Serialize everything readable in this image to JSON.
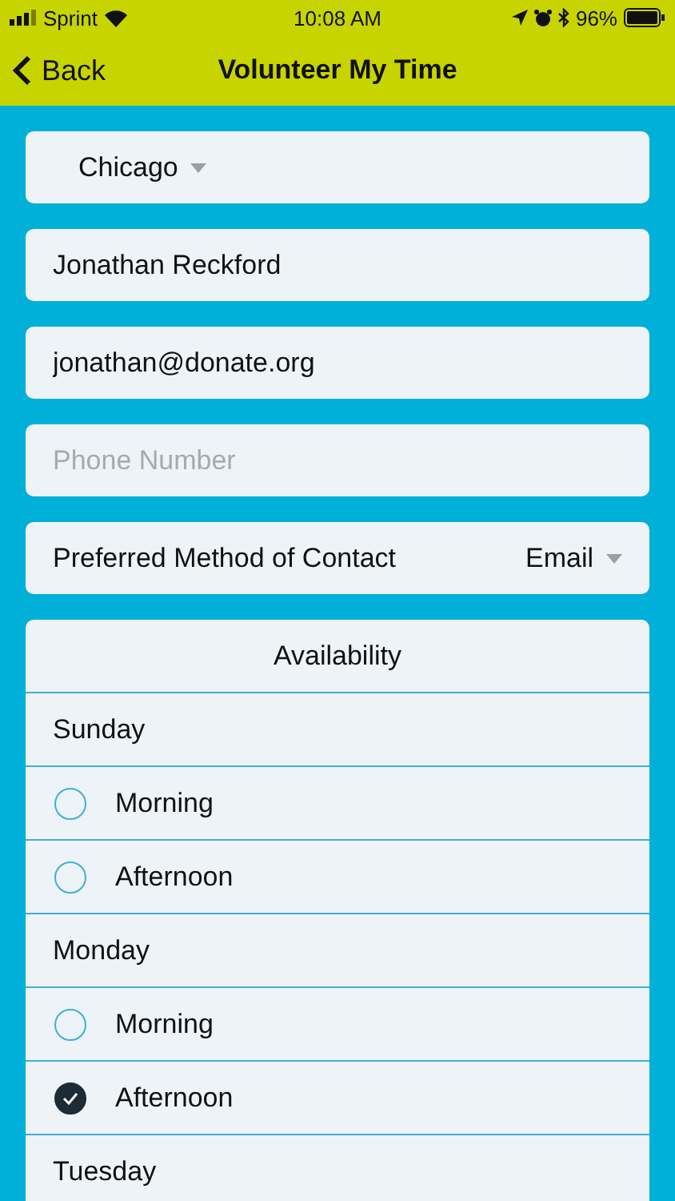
{
  "status_bar": {
    "carrier": "Sprint",
    "time": "10:08 AM",
    "battery": "96%"
  },
  "nav": {
    "back": "Back",
    "title": "Volunteer My Time"
  },
  "fields": [
    {
      "kind": "dropdown",
      "value": "Chicago"
    },
    {
      "kind": "text",
      "value": "Jonathan Reckford"
    },
    {
      "kind": "text",
      "value": "jonathan@donate.org"
    },
    {
      "kind": "text",
      "placeholder": "Phone Number"
    },
    {
      "kind": "picker",
      "label": "Preferred Method of Contact",
      "value": "Email"
    }
  ],
  "availability": {
    "title": "Availability",
    "days": [
      {
        "name": "Sunday",
        "slots": [
          {
            "label": "Morning",
            "checked": false
          },
          {
            "label": "Afternoon",
            "checked": false
          }
        ]
      },
      {
        "name": "Monday",
        "slots": [
          {
            "label": "Morning",
            "checked": false
          },
          {
            "label": "Afternoon",
            "checked": true
          }
        ]
      },
      {
        "name": "Tuesday"
      }
    ]
  }
}
